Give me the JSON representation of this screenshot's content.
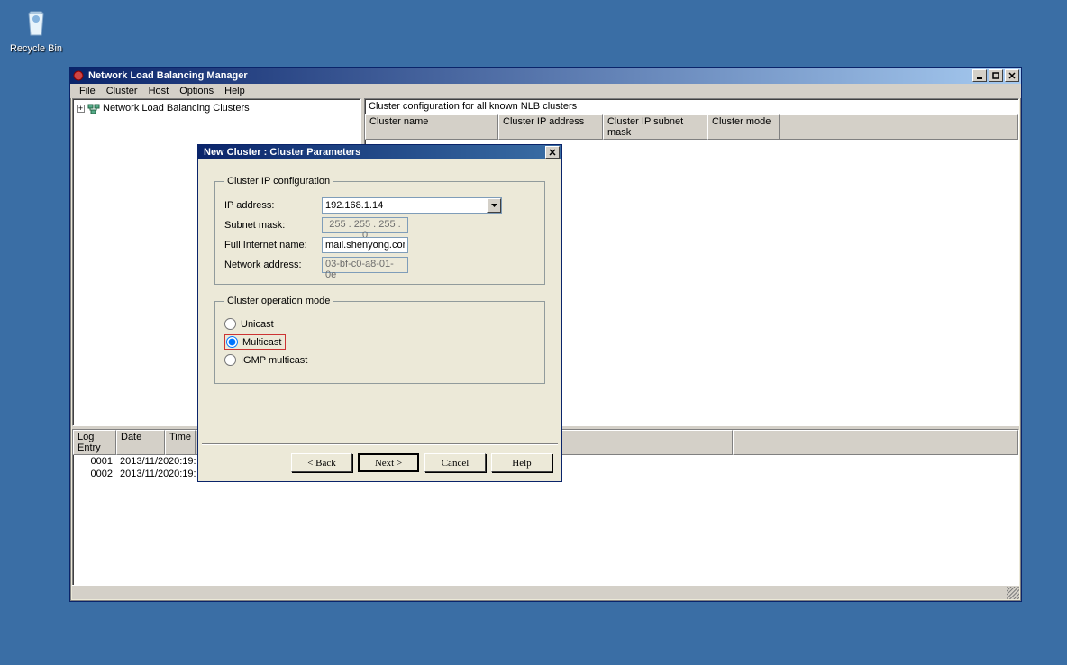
{
  "desktop": {
    "recycle_bin": "Recycle Bin"
  },
  "main_window": {
    "title": "Network Load Balancing Manager",
    "menu": {
      "file": "File",
      "cluster": "Cluster",
      "host": "Host",
      "options": "Options",
      "help": "Help"
    },
    "tree": {
      "root": "Network Load Balancing Clusters"
    },
    "list": {
      "header_text": "Cluster configuration for all known NLB clusters",
      "cols": {
        "name": "Cluster name",
        "ip": "Cluster IP address",
        "mask": "Cluster IP subnet mask",
        "mode": "Cluster mode"
      }
    },
    "log": {
      "cols": {
        "entry": "Log Entry",
        "date": "Date",
        "time": "Time",
        "rest": ""
      },
      "rows": [
        {
          "entry": "0001",
          "date": "2013/11/20",
          "time": "20:19:"
        },
        {
          "entry": "0002",
          "date": "2013/11/20",
          "time": "20:19:"
        }
      ]
    }
  },
  "dialog": {
    "title": "New Cluster : Cluster Parameters",
    "ip_config_legend": "Cluster IP configuration",
    "labels": {
      "ip": "IP address:",
      "mask": "Subnet mask:",
      "name": "Full Internet name:",
      "netaddr": "Network address:"
    },
    "values": {
      "ip": "192.168.1.14",
      "mask": "255 . 255 . 255 .   0",
      "name": "mail.shenyong.com",
      "netaddr": "03-bf-c0-a8-01-0e"
    },
    "op_mode_legend": "Cluster operation mode",
    "modes": {
      "unicast": "Unicast",
      "multicast": "Multicast",
      "igmp": "IGMP multicast"
    },
    "buttons": {
      "back": "< Back",
      "next": "Next >",
      "cancel": "Cancel",
      "help": "Help"
    }
  }
}
